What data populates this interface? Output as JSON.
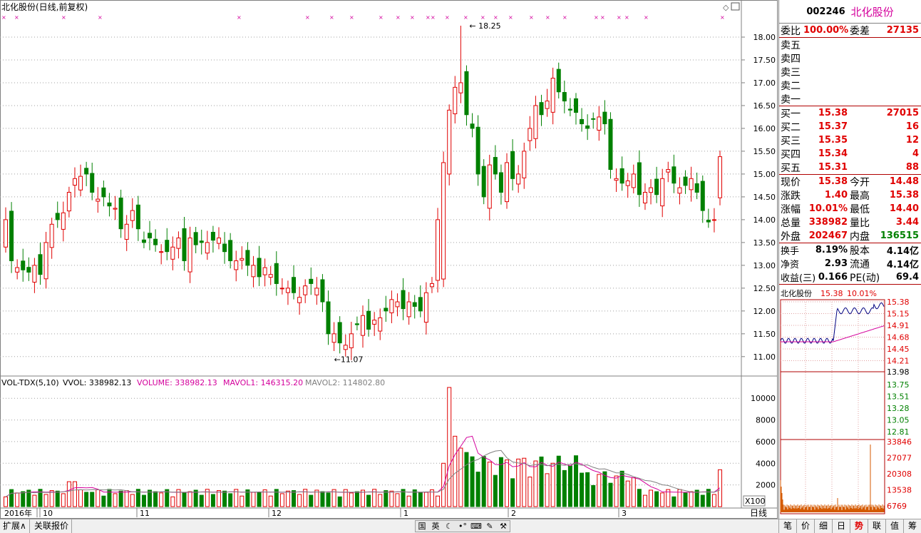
{
  "main": {
    "title": "北化股份(日线,前复权)",
    "high_label": "18.25",
    "low_label": "11.07",
    "y_ticks": [
      "18.00",
      "17.50",
      "17.00",
      "16.50",
      "16.00",
      "15.50",
      "15.00",
      "14.50",
      "14.00",
      "13.50",
      "13.00",
      "12.50",
      "12.00",
      "11.50",
      "11.00"
    ],
    "diamond_icon": "diamond-icon",
    "window_icon": "window-icon"
  },
  "volume": {
    "label": "VOL-TDX(5,10)",
    "vvol": "VVOL: 338982.13",
    "volume": "VOLUME: 338982.13",
    "mavol1": "MAVOL1: 146315.20",
    "mavol2": "MAVOL2: 114802.80",
    "y_ticks": [
      "10000",
      "8000",
      "6000",
      "4000",
      "2000"
    ],
    "unit": "X100",
    "colors": {
      "volume": "#d4009c",
      "mavol1": "#d4009c",
      "mavol2": "#808080"
    }
  },
  "time_axis": {
    "labels": [
      "2016年",
      "10",
      "11",
      "12",
      "1",
      "2",
      "3"
    ],
    "period": "日线"
  },
  "quote": {
    "code": "002246",
    "name": "北化股份",
    "weibi_label": "委比",
    "weibi": "100.00%",
    "weicha_label": "委差",
    "weicha": "27135",
    "sell": [
      {
        "label": "卖五"
      },
      {
        "label": "卖四"
      },
      {
        "label": "卖三"
      },
      {
        "label": "卖二"
      },
      {
        "label": "卖一"
      }
    ],
    "buy": [
      {
        "label": "买一",
        "price": "15.38",
        "vol": "27015"
      },
      {
        "label": "买二",
        "price": "15.37",
        "vol": "16"
      },
      {
        "label": "买三",
        "price": "15.35",
        "vol": "12"
      },
      {
        "label": "买四",
        "price": "15.34",
        "vol": "4"
      },
      {
        "label": "买五",
        "price": "15.31",
        "vol": "88"
      }
    ],
    "stats": [
      {
        "l1": "现价",
        "v1": "15.38",
        "c1": "red",
        "l2": "今开",
        "v2": "14.48",
        "c2": "red"
      },
      {
        "l1": "涨跌",
        "v1": "1.40",
        "c1": "red",
        "l2": "最高",
        "v2": "15.38",
        "c2": "red"
      },
      {
        "l1": "涨幅",
        "v1": "10.01%",
        "c1": "red",
        "l2": "最低",
        "v2": "14.40",
        "c2": "red"
      },
      {
        "l1": "总量",
        "v1": "338982",
        "c1": "red",
        "l2": "量比",
        "v2": "3.44",
        "c2": "red"
      },
      {
        "l1": "外盘",
        "v1": "202467",
        "c1": "red",
        "l2": "内盘",
        "v2": "136515",
        "c2": "green"
      }
    ],
    "stats2": [
      {
        "l1": "换手",
        "v1": "8.19%",
        "l2": "股本",
        "v2": "4.14亿"
      },
      {
        "l1": "净资",
        "v1": "2.93",
        "l2": "流通",
        "v2": "4.14亿"
      },
      {
        "l1": "收益(三)",
        "v1": "0.166",
        "l2": "PE(动)",
        "v2": "69.4"
      }
    ]
  },
  "mini": {
    "name": "北化股份",
    "price": "15.38",
    "pct": "10.01%",
    "price_ticks_up": [
      "15.38",
      "15.15",
      "14.91",
      "14.68",
      "14.45",
      "14.21"
    ],
    "price_mid": "13.98",
    "price_ticks_down": [
      "13.75",
      "13.51",
      "13.28",
      "13.05",
      "12.81"
    ],
    "vol_ticks": [
      "33846",
      "27077",
      "20308",
      "13538",
      "6769"
    ]
  },
  "bottom": {
    "expand": "扩展∧",
    "related": "关联报价",
    "tools": [
      "国",
      "英",
      "☾",
      "•°",
      "⌨",
      "✎",
      "⚒"
    ],
    "tabs": [
      "笔",
      "价",
      "细",
      "日",
      "势",
      "联",
      "值",
      "筹"
    ],
    "active_tab": "势"
  }
}
